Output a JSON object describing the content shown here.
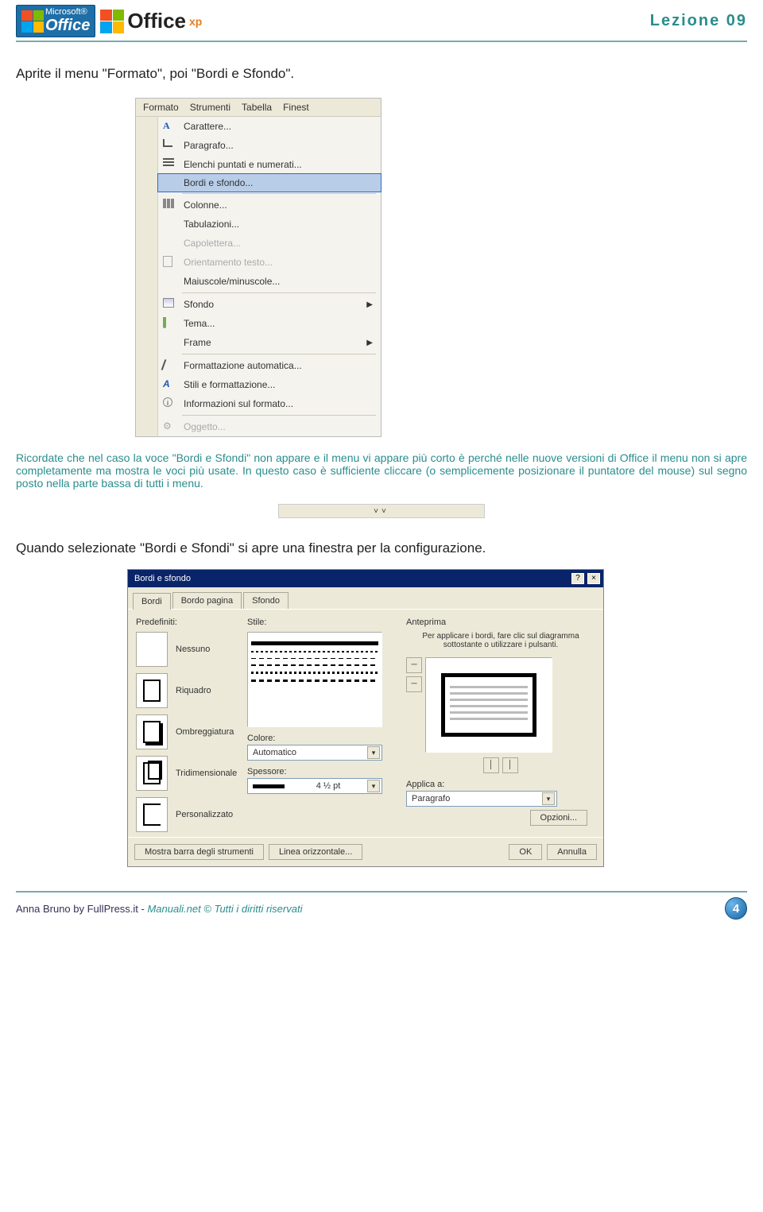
{
  "header": {
    "office_badge_ms": "Microsoft®",
    "office_badge_of": "Office",
    "officexp_txt": "Office",
    "officexp_xp": "xp",
    "lezione": "Lezione 09"
  },
  "para_intro": "Aprite il menu \"Formato\", poi \"Bordi e Sfondo\".",
  "menu": {
    "bar": [
      "Formato",
      "Strumenti",
      "Tabella",
      "Finest"
    ],
    "items": [
      {
        "label": "Carattere...",
        "icon": "A"
      },
      {
        "label": "Paragrafo...",
        "icon": "para"
      },
      {
        "label": "Elenchi puntati e numerati...",
        "icon": "list"
      },
      {
        "label": "Bordi e sfondo...",
        "icon": "",
        "sel": true
      },
      {
        "label": "Colonne...",
        "icon": "cols",
        "sep_before": true
      },
      {
        "label": "Tabulazioni...",
        "icon": ""
      },
      {
        "label": "Capolettera...",
        "icon": "",
        "dim": true
      },
      {
        "label": "Orientamento testo...",
        "icon": "vtext",
        "dim": true
      },
      {
        "label": "Maiuscole/minuscole...",
        "icon": ""
      },
      {
        "label": "Sfondo",
        "icon": "pic",
        "arrow": true,
        "sep_before": true
      },
      {
        "label": "Tema...",
        "icon": "brush"
      },
      {
        "label": "Frame",
        "icon": "",
        "arrow": true
      },
      {
        "label": "Formattazione automatica...",
        "icon": "magic",
        "sep_before": true
      },
      {
        "label": "Stili e formattazione...",
        "icon": "styles"
      },
      {
        "label": "Informazioni sul formato...",
        "icon": "info"
      },
      {
        "label": "Oggetto...",
        "icon": "chain",
        "dim": true,
        "sep_before": true
      }
    ]
  },
  "para_blue": "Ricordate che nel caso la voce \"Bordi e Sfondi\" non appare e il menu vi appare più corto è perché nelle nuove versioni di Office il menu non si apre completamente ma mostra le voci più usate. In questo caso è sufficiente cliccare (o semplicemente posizionare il puntatore del mouse) sul segno posto nella parte bassa di tutti i menu.",
  "para_after": "Quando selezionate \"Bordi e Sfondi\" si apre una finestra per la configurazione.",
  "dialog": {
    "title": "Bordi e sfondo",
    "tabs": [
      "Bordi",
      "Bordo pagina",
      "Sfondo"
    ],
    "predef_label": "Predefiniti:",
    "presets": [
      "Nessuno",
      "Riquadro",
      "Ombreggiatura",
      "Tridimensionale",
      "Personalizzato"
    ],
    "stile_label": "Stile:",
    "colore_label": "Colore:",
    "colore_value": "Automatico",
    "spessore_label": "Spessore:",
    "spessore_value": "4 ½ pt",
    "anteprima_label": "Anteprima",
    "anteprima_desc": "Per applicare i bordi, fare clic sul diagramma sottostante o utilizzare i pulsanti.",
    "applica_label": "Applica a:",
    "applica_value": "Paragrafo",
    "opzioni": "Opzioni...",
    "mostra_barra": "Mostra barra degli strumenti",
    "linea_orizz": "Linea orizzontale...",
    "ok": "OK",
    "annulla": "Annulla"
  },
  "footer": {
    "left_plain": "Anna Bruno by FullPress.it - ",
    "left_italic": "Manuali.net © Tutti i diritti riservati",
    "page": "4"
  }
}
